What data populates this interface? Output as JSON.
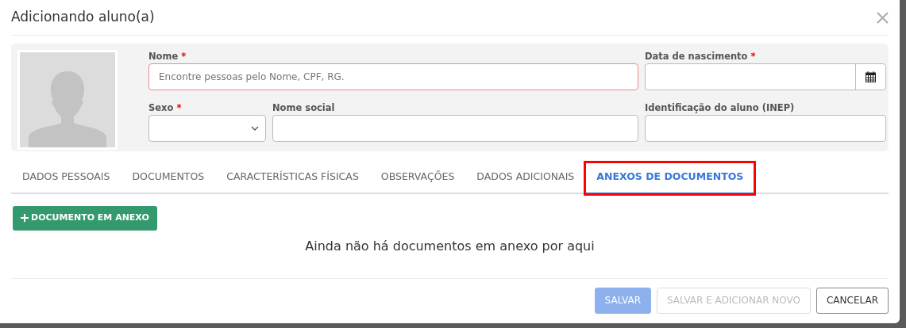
{
  "modal": {
    "title": "Adicionando aluno(a)"
  },
  "fields": [
    {
      "label": "Nome",
      "required_mark": "*",
      "kind": "text",
      "placeholder": "Encontre pessoas pelo Nome, CPF, RG.",
      "invalid": true
    },
    {
      "label": "Data de nascimento",
      "required_mark": "*",
      "kind": "date",
      "invalid": false
    },
    {
      "label": "Sexo",
      "required_mark": "*",
      "kind": "select",
      "invalid": false
    },
    {
      "label": "Nome social",
      "kind": "text",
      "invalid": false
    },
    {
      "label": "Identificação do aluno (INEP)",
      "kind": "text",
      "invalid": false
    }
  ],
  "tabs": [
    {
      "label": "DADOS PESSOAIS",
      "selected": false,
      "highlighted": false
    },
    {
      "label": "DOCUMENTOS",
      "selected": false,
      "highlighted": false
    },
    {
      "label": "CARACTERÍSTICAS FÍSICAS",
      "selected": false,
      "highlighted": false
    },
    {
      "label": "OBSERVAÇÕES",
      "selected": false,
      "highlighted": false
    },
    {
      "label": "DADOS ADICIONAIS",
      "selected": false,
      "highlighted": false
    },
    {
      "label": "ANEXOS DE DOCUMENTOS",
      "selected": true,
      "highlighted": true
    }
  ],
  "add_button": {
    "label": "DOCUMENTO EM ANEXO"
  },
  "empty_message": "Ainda não há documentos em anexo por aqui",
  "footer_buttons": [
    {
      "label": "SALVAR",
      "kind": "primary",
      "disabled": true
    },
    {
      "label": "SALVAR E ADICIONAR NOVO",
      "kind": "outline",
      "disabled": true
    },
    {
      "label": "CANCELAR",
      "kind": "outline",
      "disabled": false
    }
  ]
}
